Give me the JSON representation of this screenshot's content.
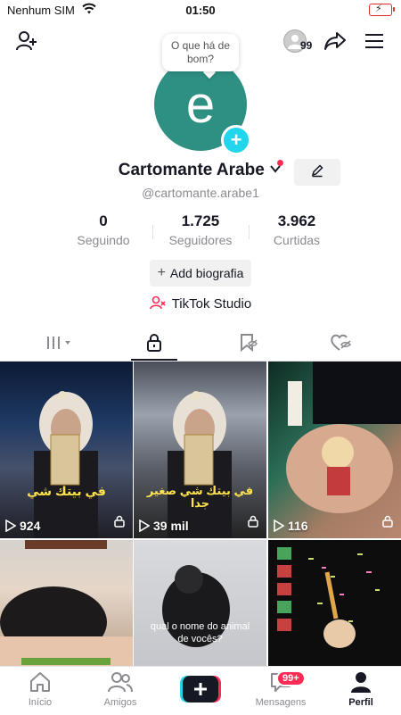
{
  "status_bar": {
    "carrier": "Nenhum SIM",
    "time": "01:50"
  },
  "header": {
    "story_count": "99",
    "bubble_text": "O que há de bom?"
  },
  "profile": {
    "avatar_letter": "e",
    "display_name": "Cartomante Arabe",
    "username": "@cartomante.arabe1",
    "stats": [
      {
        "value": "0",
        "label": "Seguindo"
      },
      {
        "value": "1.725",
        "label": "Seguidores"
      },
      {
        "value": "3.962",
        "label": "Curtidas"
      }
    ],
    "add_bio_label": "Add biografia",
    "studio_label": "TikTok Studio"
  },
  "videos": [
    {
      "views": "924",
      "overlay": "في بيتك شي"
    },
    {
      "views": "39 mil",
      "overlay": "في بيتك شي صغير جدا"
    },
    {
      "views": "116",
      "overlay": ""
    },
    {
      "views": "",
      "overlay": ""
    },
    {
      "views": "",
      "overlay": "qual o nome do animal de vocês?"
    },
    {
      "views": "",
      "overlay": ""
    }
  ],
  "bottom_nav": [
    {
      "label": "Início"
    },
    {
      "label": "Amigos"
    },
    {
      "label": ""
    },
    {
      "label": "Mensagens",
      "badge": "99+"
    },
    {
      "label": "Perfil"
    }
  ]
}
